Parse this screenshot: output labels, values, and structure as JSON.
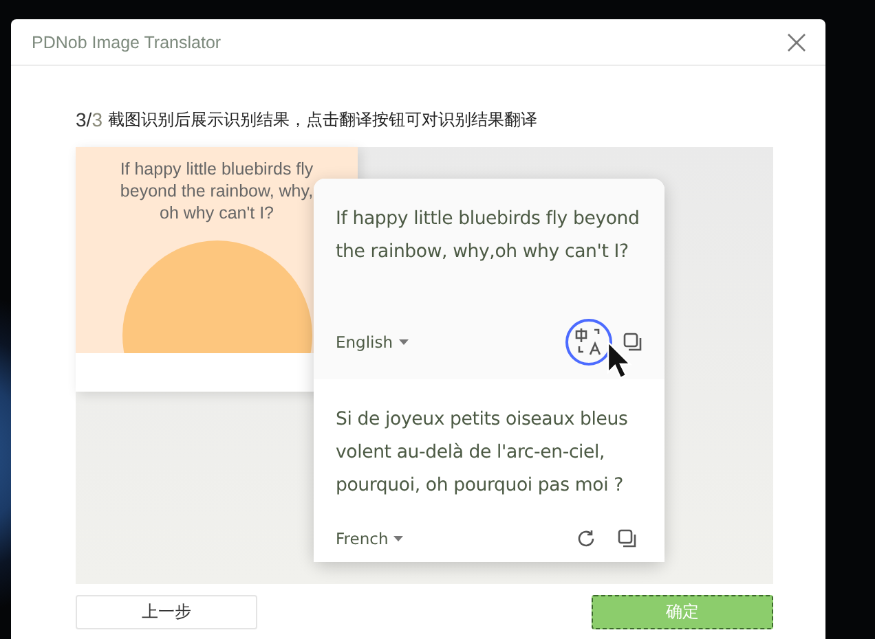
{
  "window": {
    "title": "PDNob Image Translator"
  },
  "step": {
    "current": "3/",
    "total": "3",
    "instruction": "截图识别后展示识别结果，点击翻译按钮可对识别结果翻译"
  },
  "screenshot": {
    "text": "If happy little bluebirds fly beyond the rainbow, why, oh why can't I?"
  },
  "popup": {
    "source": {
      "text": "If happy little bluebirds fly beyond the rainbow, why,oh why can't I?",
      "language": "English",
      "translate_focused": true
    },
    "target": {
      "text": "Si de joyeux petits oiseaux bleus volent au-delà de l'arc-en-ciel, pourquoi, oh pourquoi pas moi ?",
      "language": "French"
    }
  },
  "buttons": [
    {
      "label": "上一步",
      "kind": "secondary"
    },
    {
      "label": "确定",
      "kind": "primary"
    }
  ]
}
